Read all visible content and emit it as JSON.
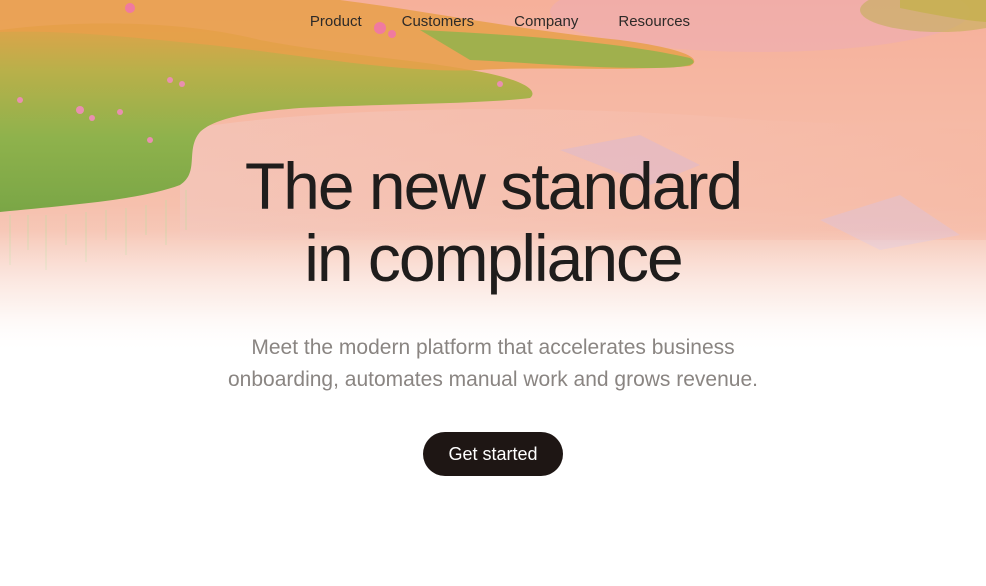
{
  "nav": {
    "items": [
      {
        "label": "Product"
      },
      {
        "label": "Customers"
      },
      {
        "label": "Company"
      },
      {
        "label": "Resources"
      }
    ]
  },
  "hero": {
    "title_line1": "The new standard",
    "title_line2": "in compliance",
    "subtitle_line1": "Meet the modern platform that accelerates business",
    "subtitle_line2": "onboarding, automates manual work and grows revenue.",
    "cta_label": "Get started"
  },
  "colors": {
    "cta_background": "#1e1614",
    "title_text": "#1f1d1c",
    "subtitle_text": "#8a8582",
    "background_peach": "#f4b6a0",
    "grass_green": "#8fb24c"
  }
}
